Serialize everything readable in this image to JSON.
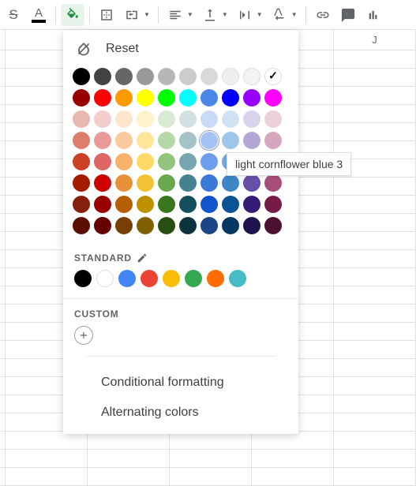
{
  "toolbar": {
    "strike_label": "S",
    "textcolor_label": "A"
  },
  "columns": [
    "",
    "",
    "",
    "",
    "J"
  ],
  "picker": {
    "reset_label": "Reset",
    "standard_label": "STANDARD",
    "custom_label": "CUSTOM",
    "cond_label": "Conditional formatting",
    "alt_label": "Alternating colors"
  },
  "tooltip": "light cornflower blue 3",
  "palette": [
    [
      "#000000",
      "#434343",
      "#666666",
      "#999999",
      "#b7b7b7",
      "#cccccc",
      "#d9d9d9",
      "#efefef",
      "#f3f3f3",
      "#ffffff"
    ],
    [
      "#980000",
      "#ff0000",
      "#ff9900",
      "#ffff00",
      "#00ff00",
      "#00ffff",
      "#4a86e8",
      "#0000ff",
      "#9900ff",
      "#ff00ff"
    ],
    [
      "#e6b8af",
      "#f4cccc",
      "#fce5cd",
      "#fff2cc",
      "#d9ead3",
      "#d0e0e3",
      "#c9daf8",
      "#cfe2f3",
      "#d9d2e9",
      "#ead1dc"
    ],
    [
      "#dd7e6b",
      "#ea9999",
      "#f9cb9c",
      "#ffe599",
      "#b6d7a8",
      "#a2c4c9",
      "#a4c2f4",
      "#9fc5e8",
      "#b4a7d6",
      "#d5a6bd"
    ],
    [
      "#cc4125",
      "#e06666",
      "#f6b26b",
      "#ffd966",
      "#93c47d",
      "#76a5af",
      "#6d9eeb",
      "#6fa8dc",
      "#8e7cc3",
      "#c27ba0"
    ],
    [
      "#a61c00",
      "#cc0000",
      "#e69138",
      "#f1c232",
      "#6aa84f",
      "#45818e",
      "#3c78d8",
      "#3d85c6",
      "#674ea7",
      "#a64d79"
    ],
    [
      "#85200c",
      "#990000",
      "#b45f06",
      "#bf9000",
      "#38761d",
      "#134f5c",
      "#1155cc",
      "#0b5394",
      "#351c75",
      "#741b47"
    ],
    [
      "#5b0f00",
      "#660000",
      "#783f04",
      "#7f6000",
      "#274e13",
      "#0c343d",
      "#1c4587",
      "#073763",
      "#20124d",
      "#4c1130"
    ]
  ],
  "standard": [
    "#000000",
    "#ffffff",
    "#4285f4",
    "#ea4335",
    "#fbbc04",
    "#34a853",
    "#ff6d01",
    "#46bdc6"
  ],
  "selected": {
    "row": 0,
    "col": 9
  },
  "hover": {
    "row": 3,
    "col": 6
  }
}
